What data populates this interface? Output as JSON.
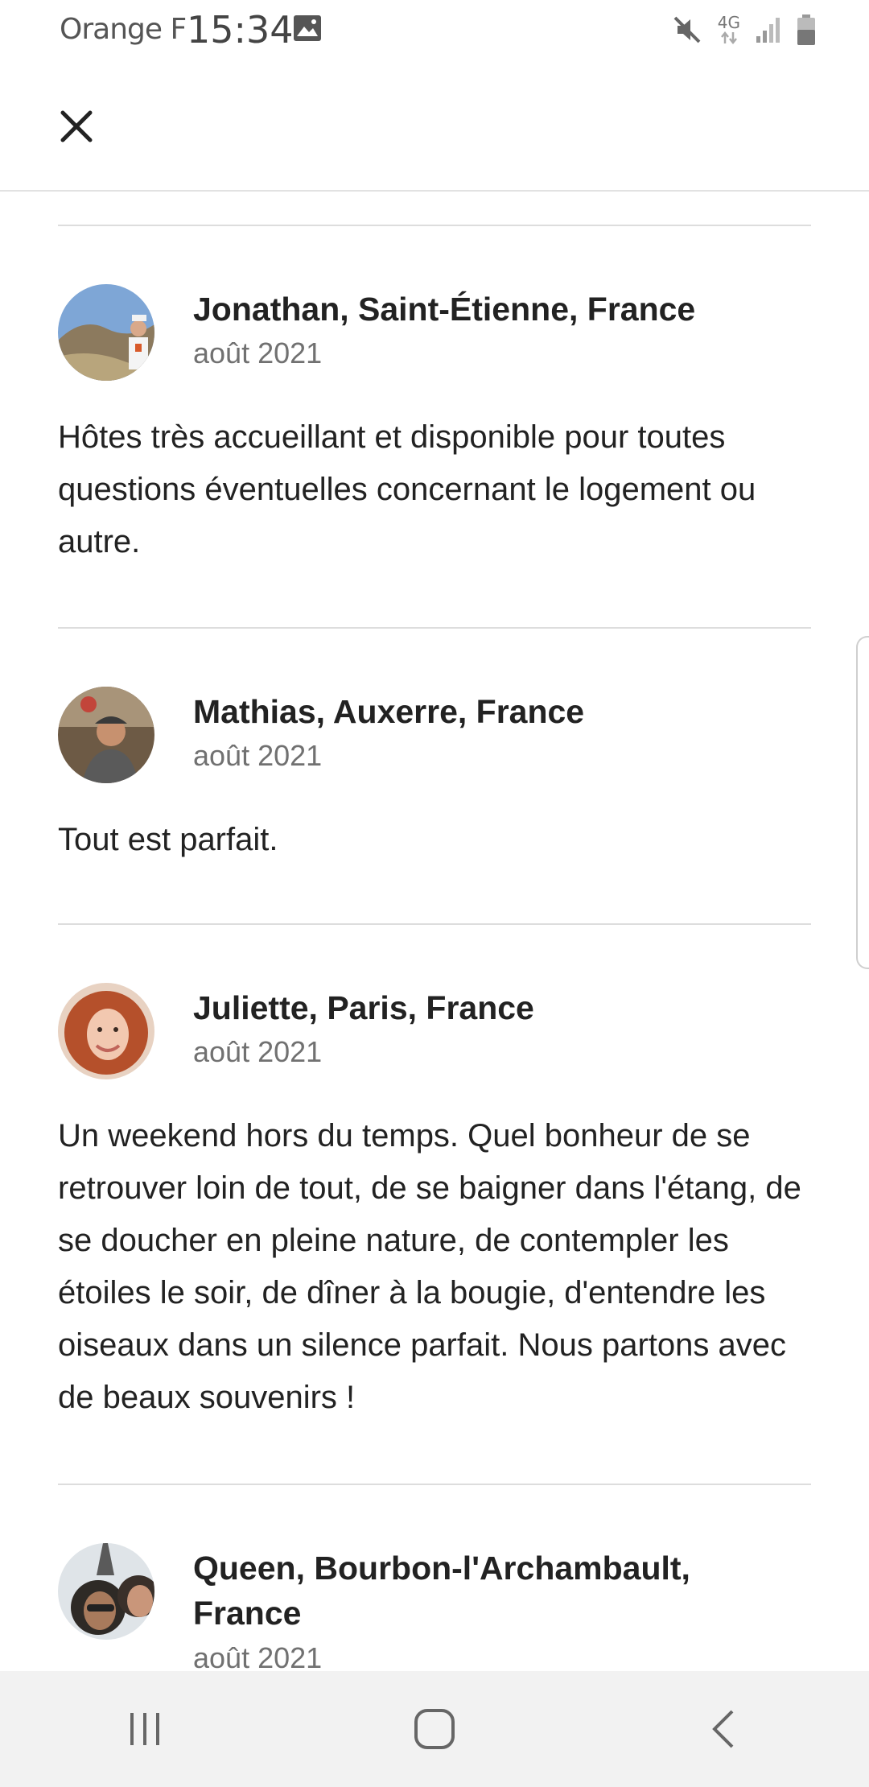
{
  "status_bar": {
    "carrier": "Orange F",
    "time": "15:34",
    "network": "4G"
  },
  "top_bar": {
    "close_icon": "close-icon"
  },
  "reviews": [
    {
      "name": "Jonathan, Saint-Étienne, France",
      "date": "août 2021",
      "text": "Hôtes très accueillant et disponible pour toutes questions éventuelles concernant le logement ou autre."
    },
    {
      "name": "Mathias, Auxerre, France",
      "date": "août 2021",
      "text": "Tout est parfait."
    },
    {
      "name": "Juliette, Paris, France",
      "date": "août 2021",
      "text": "Un weekend hors du temps. Quel bonheur de se retrouver loin de tout, de se baigner dans l'étang, de se doucher en pleine nature, de contempler les étoiles le soir, de dîner à la bougie, d'entendre les oiseaux dans un silence parfait. Nous partons avec de beaux souvenirs !"
    },
    {
      "name": "Queen, Bourbon-l'Archambault, France",
      "date": "août 2021",
      "text": ""
    }
  ],
  "nav_bar": {
    "recents_icon": "recent-apps-icon",
    "home_icon": "home-icon",
    "back_icon": "back-icon"
  },
  "colors": {
    "text_primary": "#222222",
    "text_secondary": "#717171",
    "divider": "#dddddd",
    "nav_background": "#f2f2f2"
  }
}
